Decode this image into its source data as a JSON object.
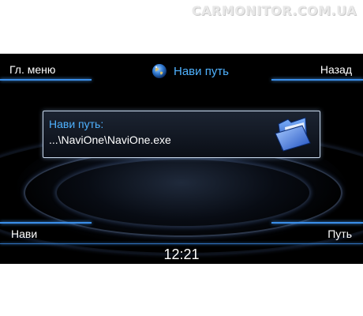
{
  "watermark": {
    "text": "CARMONITOR.COM.UA"
  },
  "header": {
    "left_label": "Гл. меню",
    "title": "Нави путь",
    "title_icon": "globe-icon",
    "right_label": "Назад"
  },
  "panel": {
    "label": "Нави путь:",
    "path": "...\\NaviOne\\NaviOne.exe",
    "folder_icon": "folder-open-icon"
  },
  "footer": {
    "left_label": "Нави",
    "right_label": "Путь",
    "clock": "12:21"
  },
  "colors": {
    "background": "#000000",
    "accent": "#4fb2ff",
    "line": "#3a8ee8",
    "text": "#ffffff"
  }
}
